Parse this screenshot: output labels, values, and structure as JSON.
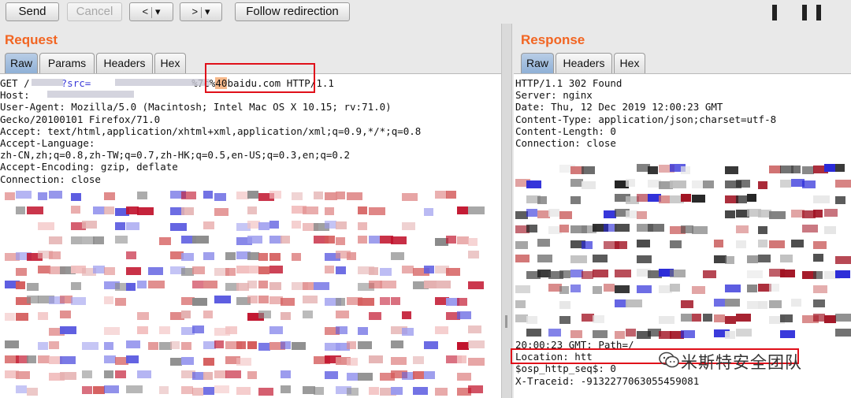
{
  "toolbar": {
    "send_label": "Send",
    "cancel_label": "Cancel",
    "back_label": "<",
    "back_menu_label": "▾",
    "forward_label": ">",
    "forward_menu_label": "▾",
    "follow_redirection_label": "Follow redirection"
  },
  "request": {
    "title": "Request",
    "tabs": [
      {
        "label": "Raw",
        "active": true
      },
      {
        "label": "Params",
        "active": false
      },
      {
        "label": "Headers",
        "active": false
      },
      {
        "label": "Hex",
        "active": false
      }
    ],
    "lines": [
      {
        "pre": "GET /",
        "hl": "40",
        "mid_before": "%7c%",
        "tail": "baidu.com HTTP/1.1",
        "visible_start": "?src="
      },
      {
        "text": "Host: "
      },
      {
        "text": "User-Agent: Mozilla/5.0 (Macintosh; Intel Mac OS X 10.15; rv:71.0)"
      },
      {
        "text": "Gecko/20100101 Firefox/71.0"
      },
      {
        "text": "Accept: text/html,application/xhtml+xml,application/xml;q=0.9,*/*;q=0.8"
      },
      {
        "text": "Accept-Language:"
      },
      {
        "text": "zh-CN,zh;q=0.8,zh-TW;q=0.7,zh-HK;q=0.5,en-US;q=0.3,en;q=0.2"
      },
      {
        "text": "Accept-Encoding: gzip, deflate"
      },
      {
        "text": "Connection: close"
      }
    ]
  },
  "response": {
    "title": "Response",
    "tabs": [
      {
        "label": "Raw",
        "active": true
      },
      {
        "label": "Headers",
        "active": false
      },
      {
        "label": "Hex",
        "active": false
      }
    ],
    "lines_top": [
      "HTTP/1.1 302 Found",
      "Server: nginx",
      "Date: Thu, 12 Dec 2019 12:00:23 GMT",
      "Content-Type: application/json;charset=utf-8",
      "Content-Length: 0",
      "Connection: close"
    ],
    "lines_bottom": [
      "20:00:23 GMT; Path=/",
      "Location: htt",
      "$osp_http_seq$: 0",
      "X-Traceid: -9132277063055459081"
    ]
  },
  "watermark": {
    "text": "米斯特安全团队",
    "icon": "wechat-icon"
  },
  "colors": {
    "accent": "#f26522",
    "annotation_red": "#e0101a",
    "highlight": "#f6b88a",
    "active_tab": "#a4bfe0"
  }
}
